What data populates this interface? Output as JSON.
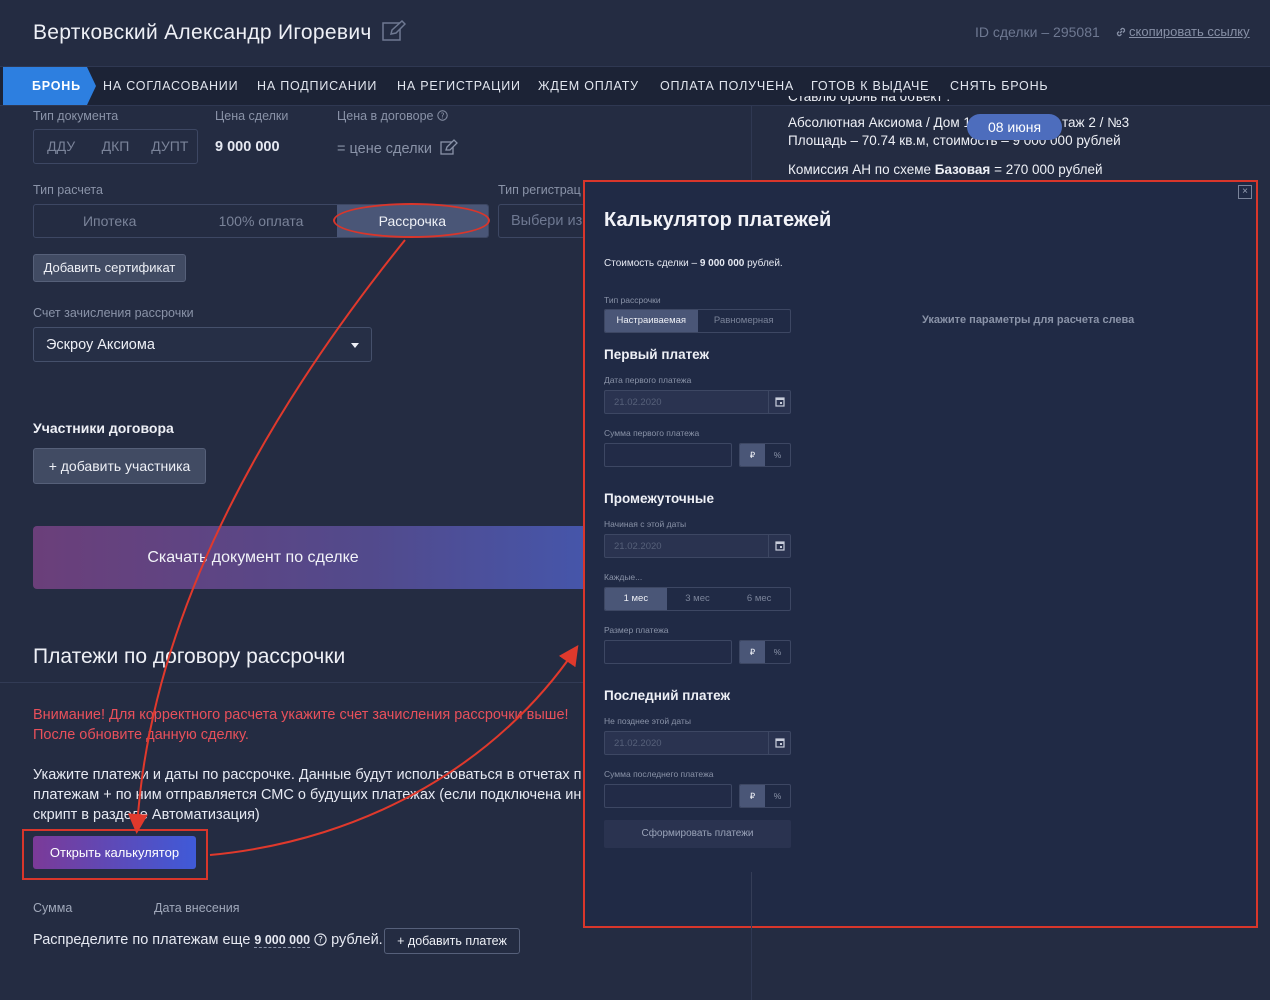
{
  "header": {
    "title": "Вертковский Александр Игоревич",
    "deal_id": "ID сделки – 295081",
    "copy_link": "скопировать ссылку"
  },
  "stages": [
    "БРОНЬ",
    "НА СОГЛАСОВАНИИ",
    "НА ПОДПИСАНИИ",
    "НА РЕГИСТРАЦИИ",
    "ЖДЕМ ОПЛАТУ",
    "ОПЛАТА ПОЛУЧЕНА",
    "ГОТОВ К ВЫДАЧЕ",
    "СНЯТЬ БРОНЬ"
  ],
  "form": {
    "doc_type_label": "Тип документа",
    "doc_types": [
      "ДДУ",
      "ДКП",
      "ДУПТ"
    ],
    "price_label": "Цена сделки",
    "price_value": "9 000 000",
    "contract_price_label": "Цена в договоре",
    "contract_price_value": "= цене сделки",
    "calc_type_label": "Тип расчета",
    "calc_types": [
      "Ипотека",
      "100% оплата",
      "Рассрочка"
    ],
    "reg_type_label": "Тип регистрац",
    "reg_type_placeholder": "Выбери из",
    "add_certificate": "Добавить сертификат",
    "account_label": "Счет зачисления рассрочки",
    "account_value": "Эскроу Аксиома",
    "participants_label": "Участники договора",
    "add_participant": "+ добавить участника",
    "download_doc": "Скачать документ по сделке"
  },
  "payments": {
    "title": "Платежи по договору рассрочки",
    "warning_1": "Внимание! Для корректного расчета укажите счет зачисления рассрочки выше!",
    "warning_2": "После обновите данную сделку.",
    "info_1": "Укажите платежи и даты по рассрочке. Данные будут использоваться в отчетах п",
    "info_2": "платежам + по ним отправляется СМС о будущих платежах (если подключена ин",
    "info_3": "скрипт в разделе Автоматизация)",
    "open_calc": "Открыть калькулятор",
    "col_sum": "Сумма",
    "col_date": "Дата внесения",
    "distribute_prefix": "Распределите по платежам еще",
    "distribute_amount": "9 000 000",
    "distribute_suffix": "рублей.",
    "add_payment": "+ добавить платеж"
  },
  "right_info": {
    "line_0": "Ставлю бронь на объект :",
    "line_1": "Абсолютная Аксиома / Дом 1",
    "line_1b": "таж 2 / №3",
    "line_2": "Площадь – 70.74 кв.м, стоимость – 9 000 000 рублей",
    "commission_prefix": "Комиссия АН по схеме",
    "commission_scheme": "Базовая",
    "commission_suffix": "= 270 000 рублей",
    "date_pill": "08 июня"
  },
  "calculator": {
    "title": "Калькулятор платежей",
    "cost_prefix": "Стоимость сделки –",
    "cost_value": "9 000 000",
    "cost_suffix": "рублей.",
    "type_label": "Тип рассрочки",
    "types": [
      "Настраиваемая",
      "Равномерная"
    ],
    "first_title": "Первый платеж",
    "first_date_label": "Дата первого платежа",
    "first_date_value": "21.02.2020",
    "first_sum_label": "Сумма первого платежа",
    "mid_title": "Промежуточные",
    "mid_start_label": "Начиная с этой даты",
    "mid_start_value": "21.02.2020",
    "every_label": "Каждые...",
    "periods": [
      "1 мес",
      "3 мес",
      "6 мес"
    ],
    "pay_size_label": "Размер платежа",
    "last_title": "Последний платеж",
    "last_date_label": "Не позднее этой даты",
    "last_date_value": "21.02.2020",
    "last_sum_label": "Сумма последнего платежа",
    "currency": "₽",
    "percent": "%",
    "form_button": "Сформировать платежи",
    "hint": "Укажите параметры для расчета слева",
    "close": "×"
  },
  "colors": {
    "accent_blue": "#2d7fe0",
    "annotation_red": "#d9362b",
    "warning_red": "#e8505b",
    "background": "#242c42"
  }
}
